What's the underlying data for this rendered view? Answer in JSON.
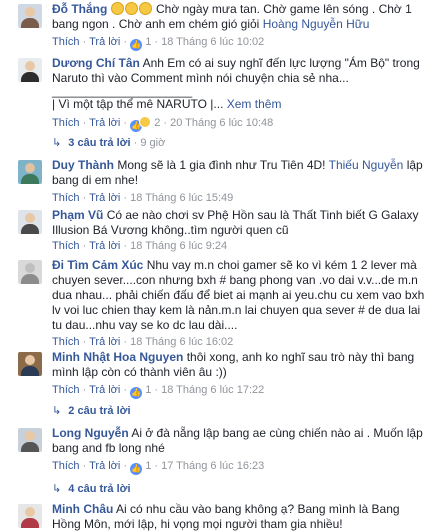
{
  "comments": [
    {
      "name": "Đỗ Thắng",
      "text": "Chờ ngày mưa tan. Chờ game lên sóng . Chờ 1 bang ngon . Chờ anh em chém gió giỏi",
      "tag": "Hoàng Nguyễn Hữu",
      "actions": {
        "like": "Thích",
        "reply": "Trả lời",
        "likes": "1",
        "time": "18 Tháng 6 lúc 10:02"
      }
    },
    {
      "name": "Dương Chí Tân",
      "text": "Anh Em có ai suy nghĩ đến lực lượng \"Ám Bộ\" trong Naruto thì vào Comment mình nói chuyện chia sẻ nha...",
      "rule": "_____________________",
      "text2": "| Vì một tập thể mê NARUTO |...",
      "more": "Xem thêm",
      "actions": {
        "like": "Thích",
        "reply": "Trả lời",
        "likes": "2",
        "time": "20 Tháng 6 lúc 10:48"
      },
      "replies": {
        "label": "3 câu trả lời",
        "time": "9 giờ"
      }
    },
    {
      "name": "Duy Thành",
      "text": "Mong sẽ là 1 gia đình như Tru Tiên 4D!",
      "tag": "Thiếu Nguyễn",
      "text_after": "lập bang di em nhe!",
      "actions": {
        "like": "Thích",
        "reply": "Trả lời",
        "time": "18 Tháng 6 lúc 15:49"
      }
    },
    {
      "name": "Phạm Vũ",
      "text": "Có ae nào chơi sv Phệ Hồn sau là Thất Tinh biết G Galaxy Illusion Bá Vương không..tìm người quen cũ",
      "actions": {
        "like": "Thích",
        "reply": "Trả lời",
        "time": "18 Tháng 6 lúc 9:24"
      }
    },
    {
      "name": "Đi Tìm Cảm Xúc",
      "text": "Nhu vay m.n choi gamer sẽ ko vì kém 1 2 lever mà chuyen sever....con nhưng bxh # bang phong van .vo dai v.v...de m.n dua nhau... phải chiến đấu để biet ai mạnh ai yeu.chu cu xem vao bxh lv voi luc chien thay kem là nản.m.n lai chuyen qua sever # de dua lai tu dau...nhu vay se ko dc lau dài....",
      "actions": {
        "like": "Thích",
        "reply": "Trả lời",
        "time": "18 Tháng 6 lúc 16:02"
      }
    },
    {
      "name": "Minh Nhật Hoa Nguyen",
      "text": "thôi xong, anh ko nghĩ sau trò này thì bang mình lập còn có thành viên âu :))",
      "actions": {
        "like": "Thích",
        "reply": "Trả lời",
        "likes": "1",
        "time": "18 Tháng 6 lúc 17:22"
      },
      "replies": {
        "label": "2 câu trả lời",
        "time": ""
      }
    },
    {
      "name": "Long Nguyễn",
      "text": "Ai ở đà nẵng lập bang ae cùng chiến nào ai . Muốn lập bang and fb long nhé",
      "actions": {
        "like": "Thích",
        "reply": "Trả lời",
        "likes": "1",
        "time": "17 Tháng 6 lúc 16:23"
      },
      "replies": {
        "label": "4 câu trả lời",
        "time": ""
      }
    },
    {
      "name": "Minh Châu",
      "text": "Ai có nhu cầu vào bang không ạ? Bang mình là Bang Hồng Môn, mới lập, hi vọng mọi người tham gia nhiều!",
      "actions": {
        "like": "",
        "reply": "",
        "time": ""
      }
    }
  ]
}
